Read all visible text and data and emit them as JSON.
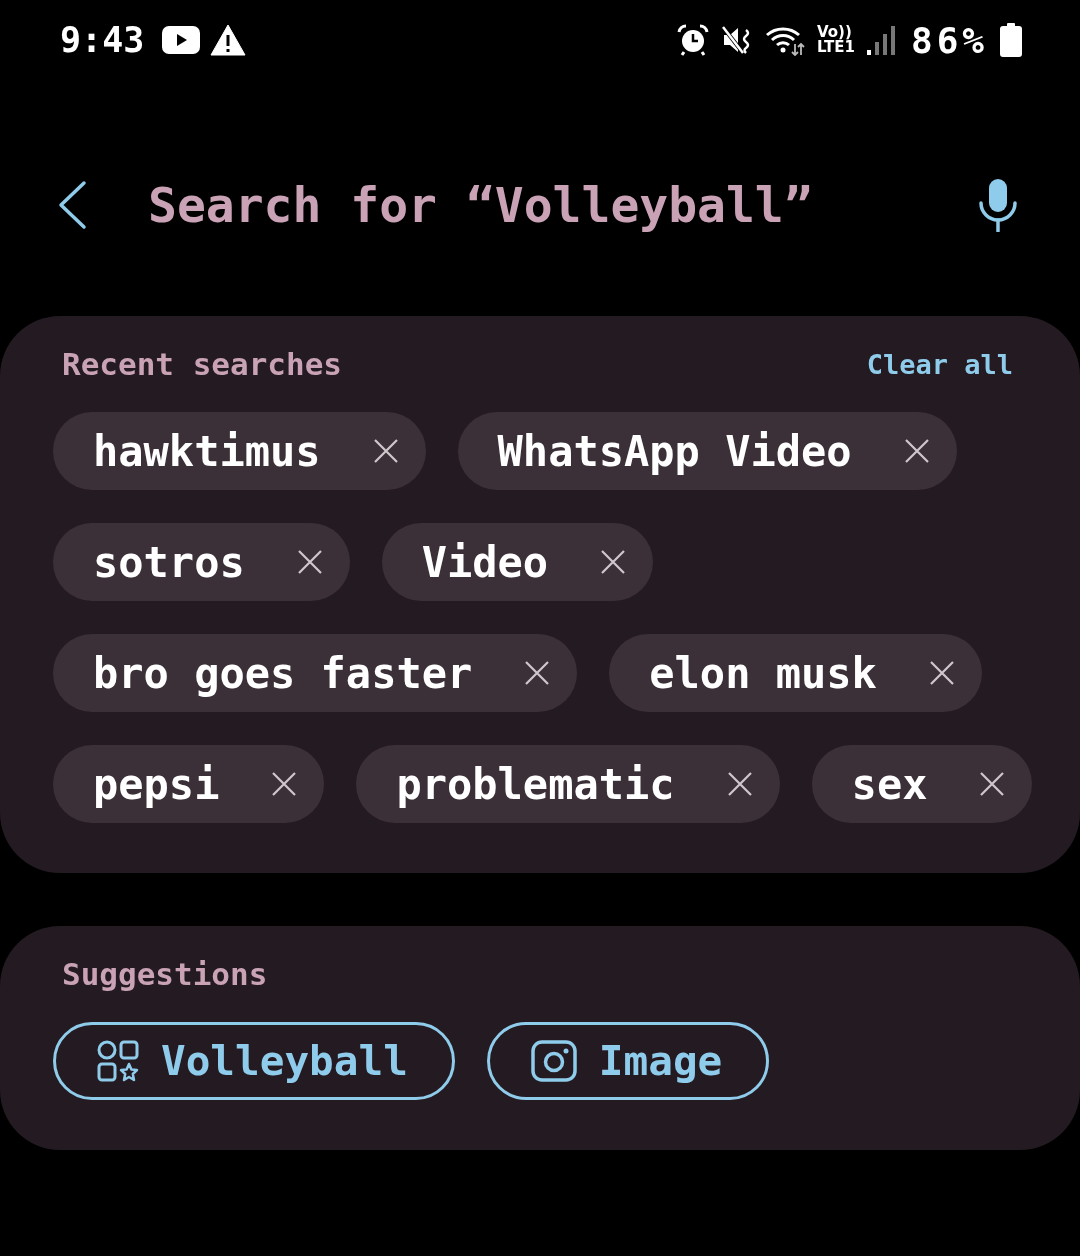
{
  "status_bar": {
    "time": "9:43",
    "volte_label": "Vo))",
    "network_label": "LTE1",
    "battery": "86%"
  },
  "header": {
    "query": "Search for “Volleyball”"
  },
  "recent_searches": {
    "title": "Recent searches",
    "clear_label": "Clear all",
    "chips": [
      {
        "label": "hawktimus"
      },
      {
        "label": "WhatsApp Video"
      },
      {
        "label": "sotros"
      },
      {
        "label": "Video"
      },
      {
        "label": "bro goes faster"
      },
      {
        "label": "elon musk"
      },
      {
        "label": "pepsi"
      },
      {
        "label": "problematic"
      },
      {
        "label": "sex"
      }
    ]
  },
  "suggestions": {
    "title": "Suggestions",
    "items": [
      {
        "label": "Volleyball",
        "kind": "apps"
      },
      {
        "label": "Image",
        "kind": "image"
      }
    ]
  }
}
